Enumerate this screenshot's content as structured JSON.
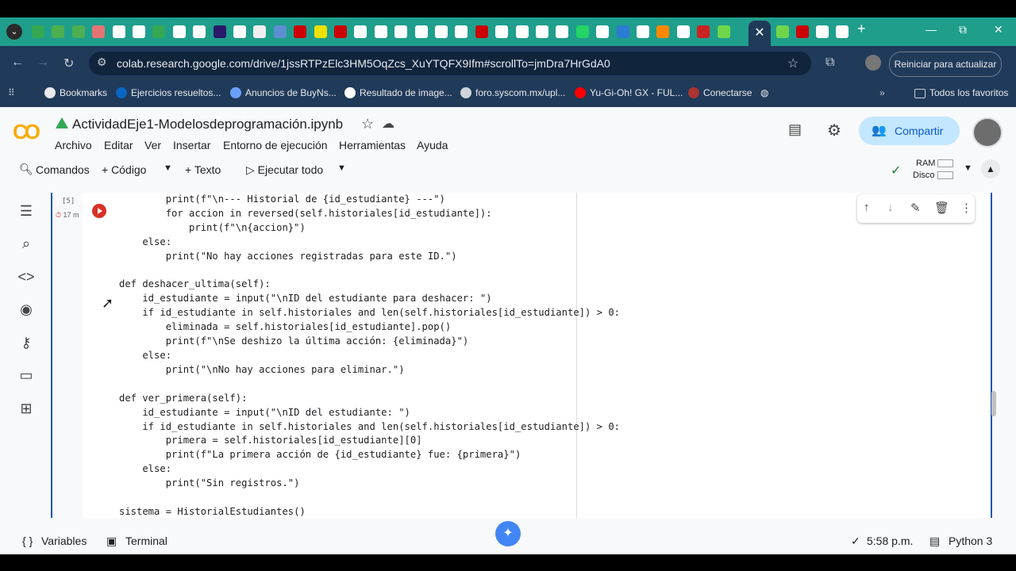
{
  "tabs": {
    "active_close": "✕",
    "new_tab": "+",
    "dropdown": "⌄"
  },
  "window": {
    "minimize": "—",
    "maximize": "⧉",
    "close": "✕"
  },
  "toolbar": {
    "url": "colab.research.google.com/drive/1jssRTPzElc3HM5OqZcs_XuYTQFX9Ifm#scrollTo=jmDra7HrGdA0",
    "update_label": "Reiniciar para actualizar"
  },
  "bookmarks": [
    {
      "label": "Bookmarks",
      "color": "#e8eaed"
    },
    {
      "label": "Ejercicios resueltos...",
      "color": "#0a66c2"
    },
    {
      "label": "Anuncios de BuyNs...",
      "color": "#6aa0ff"
    },
    {
      "label": "Resultado de image...",
      "color": "#ffffff"
    },
    {
      "label": "foro.syscom.mx/upl...",
      "color": "#cfd4da"
    },
    {
      "label": "Yu-Gi-Oh! GX - FUL...",
      "color": "#ff0000"
    },
    {
      "label": "Conectarse",
      "color": "#aa3333"
    }
  ],
  "bookmarks_all": "Todos los favoritos",
  "notebook": {
    "logo": "CO",
    "title": "ActividadEje1-Modelosdeprogramación.ipynb",
    "menu": [
      "Archivo",
      "Editar",
      "Ver",
      "Insertar",
      "Entorno de ejecución",
      "Herramientas",
      "Ayuda"
    ],
    "share": "Compartir"
  },
  "commands": {
    "search": "Comandos",
    "code": "+ Código",
    "text": "+ Texto",
    "run_all": "▷ Ejecutar todo",
    "ram": "RAM",
    "disk": "Disco"
  },
  "cell": {
    "exec_count": "[5]",
    "elapsed": "17 m",
    "code": "        print(f\"\\n--- Historial de {id_estudiante} ---\")\n        for accion in reversed(self.historiales[id_estudiante]):\n            print(f\"\\n{accion}\")\n    else:\n        print(\"No hay acciones registradas para este ID.\")\n\ndef deshacer_ultima(self):\n    id_estudiante = input(\"\\nID del estudiante para deshacer: \")\n    if id_estudiante in self.historiales and len(self.historiales[id_estudiante]) > 0:\n        eliminada = self.historiales[id_estudiante].pop()\n        print(f\"\\nSe deshizo la última acción: {eliminada}\")\n    else:\n        print(\"\\nNo hay acciones para eliminar.\")\n\ndef ver_primera(self):\n    id_estudiante = input(\"\\nID del estudiante: \")\n    if id_estudiante in self.historiales and len(self.historiales[id_estudiante]) > 0:\n        primera = self.historiales[id_estudiante][0]\n        print(f\"La primera acción de {id_estudiante} fue: {primera}\")\n    else:\n        print(\"Sin registros.\")\n\nsistema = HistorialEstudiantes()"
  },
  "status": {
    "variables": "Variables",
    "terminal": "Terminal",
    "time": "5:58 p.m.",
    "runtime": "Python 3"
  }
}
